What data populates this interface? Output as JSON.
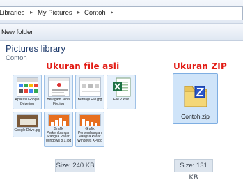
{
  "breadcrumb": {
    "items": [
      "Libraries",
      "My Pictures",
      "Contoh"
    ],
    "separator": "▸"
  },
  "toolbar": {
    "new_folder": "New folder"
  },
  "library": {
    "title": "Pictures library",
    "subtitle": "Contoh"
  },
  "labels": {
    "original": "Ukuran file asli",
    "zip": "Ukuran ZIP"
  },
  "files": [
    {
      "name": "Aplikasi Google Drive.jpg",
      "icon": "screenshot-thumbnail"
    },
    {
      "name": "Beragam Jenis File.jpg",
      "icon": "screenshot-thumbnail"
    },
    {
      "name": "Berbagi File.jpg",
      "icon": "screenshot-thumbnail"
    },
    {
      "name": "File 2.xlsx",
      "icon": "excel-icon"
    },
    {
      "name": "Google Drive.jpg",
      "icon": "screenshot-thumbnail"
    },
    {
      "name": "Grafik Perkembangan Pangsa Pasar Windows 8.1.jpg",
      "icon": "chart-thumbnail"
    },
    {
      "name": "Grafik Perkembangan Pangsa Pasar Windows XP.jpg",
      "icon": "chart-thumbnail"
    }
  ],
  "zip": {
    "name": "Contoh.zip",
    "icon": "zip-folder-icon"
  },
  "sizes": {
    "original": "Size: 240 KB",
    "zip": "Size: 131 KB"
  },
  "colors": {
    "accent": "#e21b14",
    "selection": "#cfe4f9",
    "title": "#1e3a6b"
  }
}
